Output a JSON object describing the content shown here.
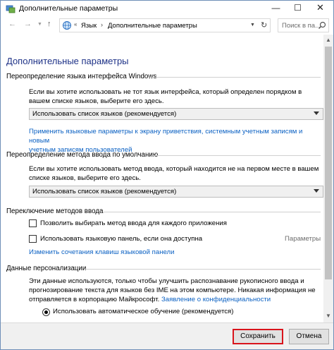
{
  "window": {
    "title": "Дополнительные параметры",
    "minimize_glyph": "—",
    "maximize_glyph": "☐",
    "close_glyph": "✕"
  },
  "nav": {
    "back_glyph": "←",
    "forward_glyph": "→",
    "recent_glyph": "▼",
    "up_glyph": "↑",
    "breadcrumb_sep1": "«",
    "breadcrumb": [
      "Язык",
      "Дополнительные параметры"
    ],
    "breadcrumb_sep2": "›",
    "dropdown_glyph": "▼",
    "refresh_glyph": "↻",
    "search_placeholder": "Поиск в па..."
  },
  "page": {
    "title": "Дополнительные параметры",
    "display_language": {
      "heading": "Переопределение языка интерфейса Windows",
      "description": "Если вы хотите использовать не тот язык интерфейса, который определен порядком в вашем списке языков, выберите его здесь.",
      "selected": "Использовать список языков (рекомендуется)",
      "link_line1": "Применить языковые параметры к экрану приветствия, системным учетным записям и новым",
      "link_line2": "учетным записям пользователей"
    },
    "input_method": {
      "heading": "Переопределение метода ввода по умолчанию",
      "description": "Если вы хотите использовать метод ввода, который находится не на первом месте в вашем списке языков, выберите его здесь.",
      "selected": "Использовать список языков (рекомендуется)"
    },
    "switching": {
      "heading": "Переключение методов ввода",
      "checkbox1": "Позволить выбирать метод ввода для каждого приложения",
      "checkbox2": "Использовать языковую панель, если она доступна",
      "options_link": "Параметры",
      "hotkeys_link": "Изменить сочетания клавиш языковой панели"
    },
    "personalization": {
      "heading": "Данные персонализации",
      "description_line1": "Эти данные используются, только чтобы улучшить распознавание рукописного ввода и",
      "description_line2": "прогнозирование текста для языков без IME на этом компьютере. Никакая информация не",
      "description_line3_text": "отправляется в корпорацию Майкрософт.",
      "privacy_link": "Заявление о конфиденциальности",
      "radio1": "Использовать автоматическое обучение (рекомендуется)"
    }
  },
  "scrollbar": {
    "up_glyph": "▲",
    "down_glyph": "▼",
    "position": 0.04
  },
  "buttons": {
    "save": "Сохранить",
    "cancel": "Отмена"
  },
  "colors": {
    "accent_title": "#1e3287",
    "link": "#0b61c3",
    "save_highlight": "#d9141c"
  }
}
